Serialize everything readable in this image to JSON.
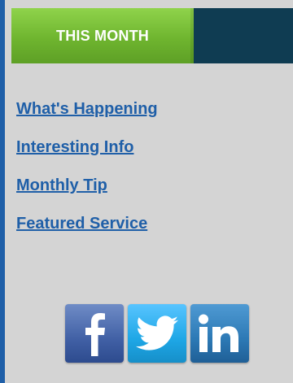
{
  "header": {
    "tab_label": "THIS MONTH"
  },
  "nav": {
    "items": [
      {
        "label": "What's Happening "
      },
      {
        "label": "Interesting Info"
      },
      {
        "label": "Monthly Tip"
      },
      {
        "label": "Featured Service"
      }
    ]
  },
  "social": {
    "icons": [
      "facebook-icon",
      "twitter-icon",
      "linkedin-icon"
    ]
  },
  "colors": {
    "accent_green": "#7bc13a",
    "dark_header": "#0f3c52",
    "link_blue": "#1f5fa8",
    "background": "#d4d4d4"
  }
}
